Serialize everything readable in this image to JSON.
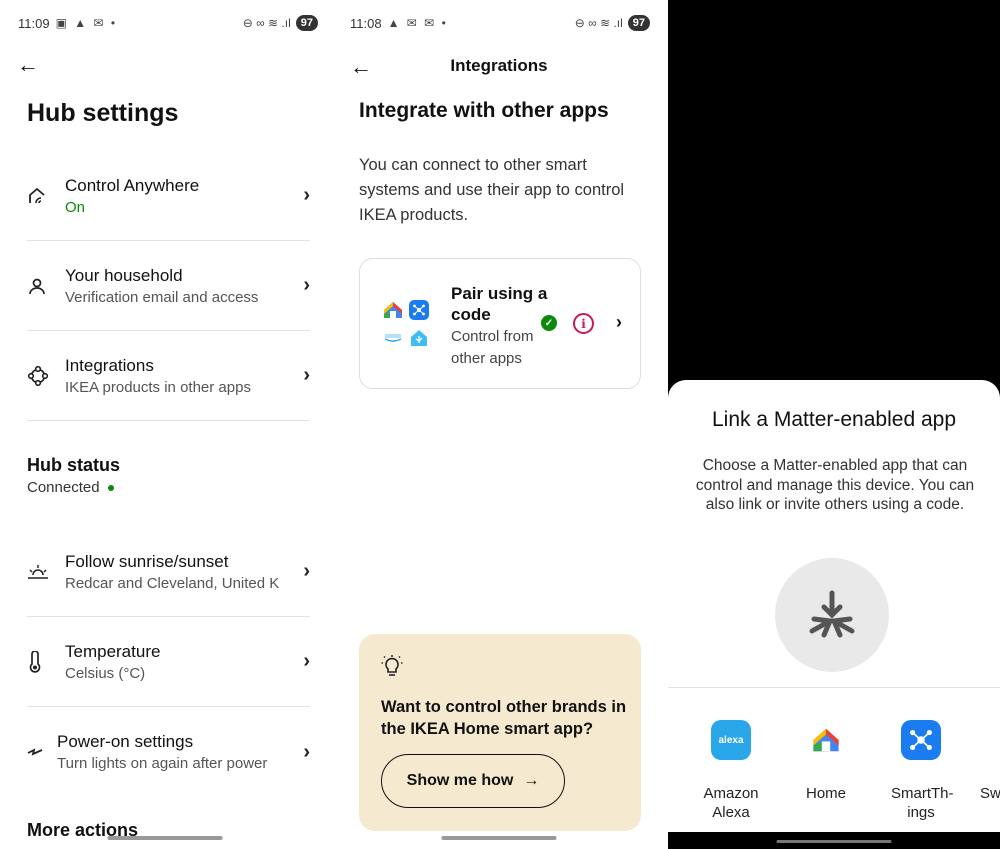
{
  "panel1": {
    "status": {
      "time": "11:09",
      "notif": "▣ ▲ ✉ •",
      "sig": "⊖ ∞ ≋ .ıl",
      "battery": "97"
    },
    "title": "Hub settings",
    "rows_top": [
      {
        "title": "Control Anywhere",
        "subtitle": "On",
        "icon": "remote-access-icon"
      },
      {
        "title": "Your household",
        "subtitle": "Verification email and access",
        "icon": "person-icon"
      },
      {
        "title": "Integrations",
        "subtitle": "IKEA products in other apps",
        "icon": "integrations-icon"
      }
    ],
    "hub_status": {
      "title": "Hub status",
      "value": "Connected",
      "color": "#0a8a0a"
    },
    "rows_bottom": [
      {
        "title": "Follow sunrise/sunset",
        "subtitle": "Redcar and Cleveland, United K",
        "icon": "sunrise-icon"
      },
      {
        "title": "Temperature",
        "subtitle": "Celsius (°C)",
        "icon": "thermometer-icon"
      },
      {
        "title": "Power-on settings",
        "subtitle": "Turn lights on again after power",
        "icon": "power-icon"
      }
    ],
    "more": "More actions"
  },
  "panel2": {
    "status": {
      "time": "11:08",
      "notif": "▲ ✉ ✉ •",
      "sig": "⊖ ∞ ≋ .ıl",
      "battery": "97"
    },
    "header": "Integrations",
    "heading": "Integrate with other apps",
    "description": "You can connect to other smart systems and use their app to control IKEA products.",
    "pair_card": {
      "title": "Pair using a code",
      "subtitle": "Control from other apps",
      "info": "i",
      "check": "✓"
    },
    "promo": {
      "title": "Want to control other brands in the IKEA Home smart app?",
      "button": "Show me how",
      "arrow": "→"
    }
  },
  "panel3": {
    "title": "Link a Matter-enabled app",
    "description": "Choose a Matter-enabled app that can control and manage this device. You can also link or invite others using a code.",
    "apps": [
      {
        "label": "Amazon Alexa",
        "icon": "alexa-icon",
        "mark": "alexa"
      },
      {
        "label": "Home",
        "icon": "google-home-icon"
      },
      {
        "label": "SmartTh-ings",
        "icon": "smartthings-icon"
      },
      {
        "label": "Sw",
        "icon": "partial-app-icon"
      }
    ]
  },
  "colors": {
    "green": "#0a8a0a",
    "info_red": "#c41b5c",
    "promo_bg": "#f5ead0",
    "smartthings_blue": "#1b7cf0",
    "alexa_blue": "#2aa7e8"
  }
}
